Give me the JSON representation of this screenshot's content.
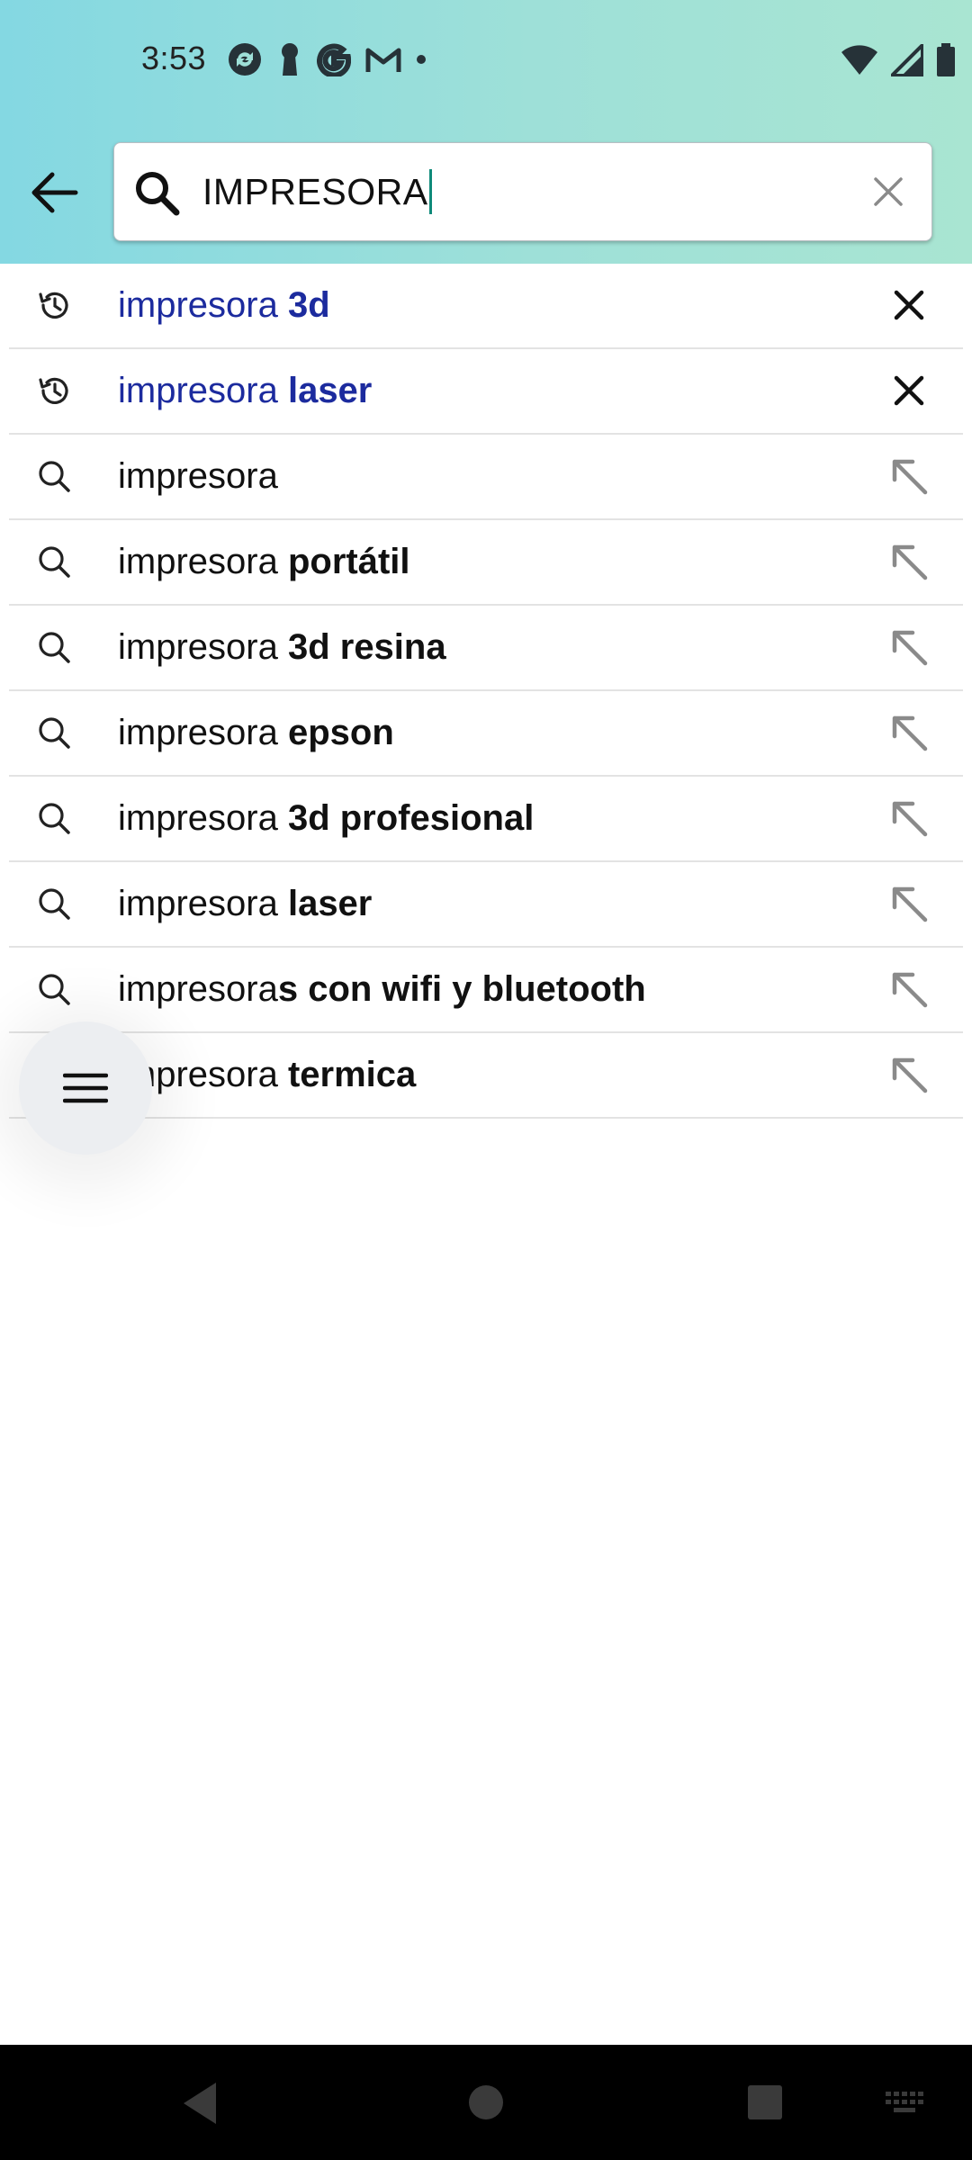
{
  "status_bar": {
    "time": "3:53",
    "notification_icons": [
      "sync-icon",
      "keyhole-icon",
      "google-icon",
      "gmail-icon",
      "dot-icon"
    ],
    "system_icons": [
      "wifi-icon",
      "signal-icon",
      "battery-icon"
    ]
  },
  "search": {
    "query": "IMPRESORA",
    "placeholder": ""
  },
  "suggestions": [
    {
      "type": "history",
      "prefix": "impresora ",
      "bold": "3d"
    },
    {
      "type": "history",
      "prefix": "impresora ",
      "bold": "laser"
    },
    {
      "type": "query",
      "prefix": "impresora",
      "bold": ""
    },
    {
      "type": "query",
      "prefix": "impresora ",
      "bold": "portátil"
    },
    {
      "type": "query",
      "prefix": "impresora ",
      "bold": "3d resina"
    },
    {
      "type": "query",
      "prefix": "impresora ",
      "bold": "epson"
    },
    {
      "type": "query",
      "prefix": "impresora ",
      "bold": "3d profesional"
    },
    {
      "type": "query",
      "prefix": "impresora ",
      "bold": "laser"
    },
    {
      "type": "query",
      "prefix": "impresora",
      "bold": "s con wifi y bluetooth"
    },
    {
      "type": "query",
      "prefix": "impresora ",
      "bold": "termica"
    }
  ],
  "colors": {
    "header_gradient_start": "#84d8e2",
    "header_gradient_end": "#a9e5d2",
    "history_text": "#1c2b9e",
    "caret": "#0f8a7a"
  }
}
